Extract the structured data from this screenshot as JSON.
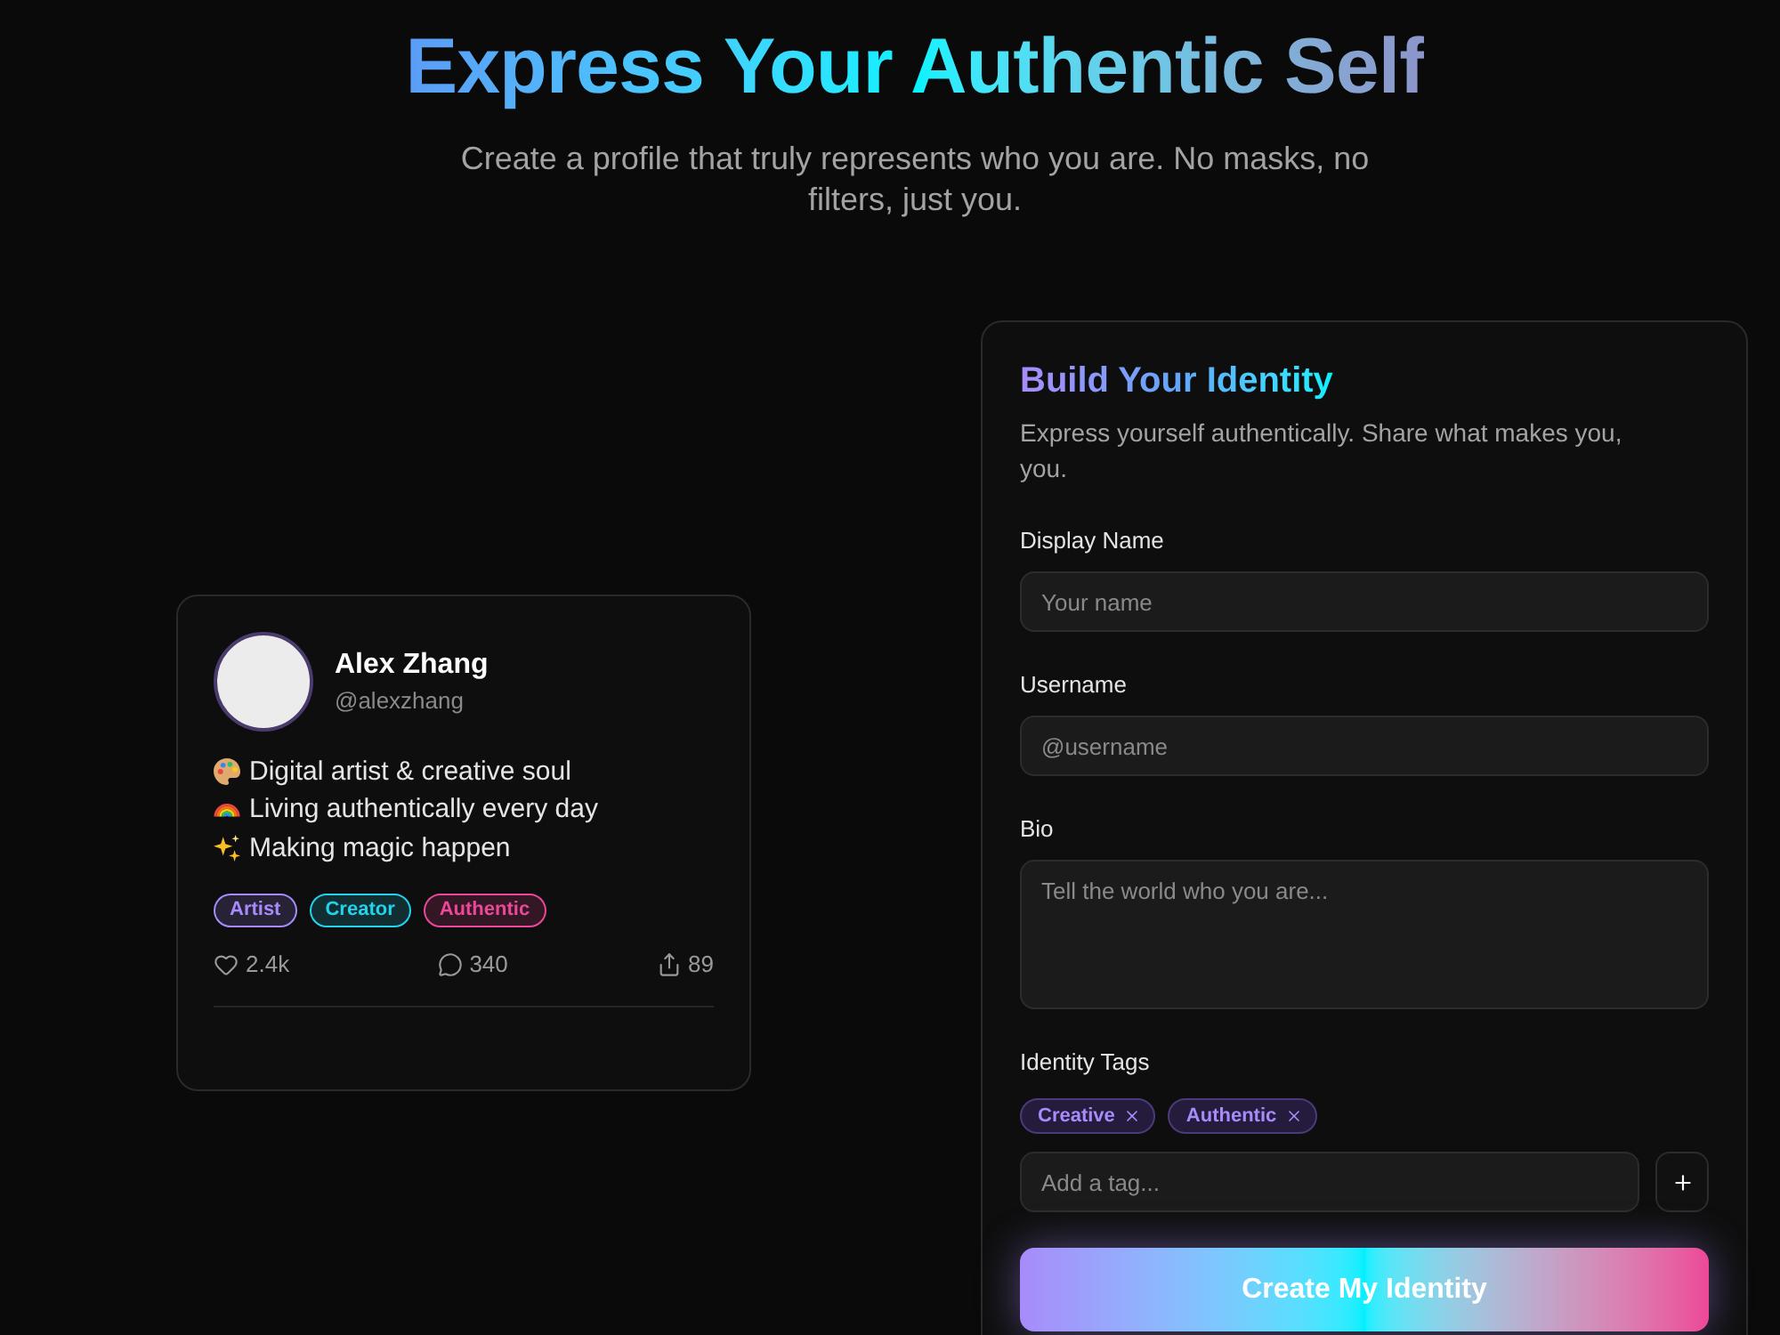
{
  "header": {
    "title": "Express Your Authentic Self",
    "subtitle": "Create a profile that truly represents who you are. No masks, no filters, just you."
  },
  "preview_card": {
    "name": "Alex Zhang",
    "handle": "@alexzhang",
    "bio_lines": [
      {
        "kind": "palette",
        "text": "Digital artist & creative soul"
      },
      {
        "kind": "rainbow",
        "text": "Living authentically every day"
      },
      {
        "kind": "sparkles",
        "text": "Making magic happen"
      }
    ],
    "tags": [
      {
        "label": "Artist",
        "color": "#a78bfa"
      },
      {
        "label": "Creator",
        "color": "#22d3ee"
      },
      {
        "label": "Authentic",
        "color": "#ec4899"
      }
    ],
    "stats": [
      {
        "kind": "likes",
        "value": "2.4k"
      },
      {
        "kind": "comments",
        "value": "340"
      },
      {
        "kind": "shares",
        "value": "89"
      }
    ]
  },
  "form": {
    "title": "Build Your Identity",
    "description": "Express yourself authentically. Share what makes you, you.",
    "fields": [
      {
        "kind": "input",
        "label": "Display Name",
        "placeholder": "Your name"
      },
      {
        "kind": "input",
        "label": "Username",
        "placeholder": "@username"
      },
      {
        "kind": "textarea",
        "label": "Bio",
        "placeholder": "Tell the world who you are..."
      }
    ],
    "tags": {
      "label": "Identity Tags",
      "items": [
        "Creative",
        "Authentic"
      ],
      "input": {
        "placeholder": "Add a tag..."
      }
    },
    "submit": "Create My Identity"
  }
}
